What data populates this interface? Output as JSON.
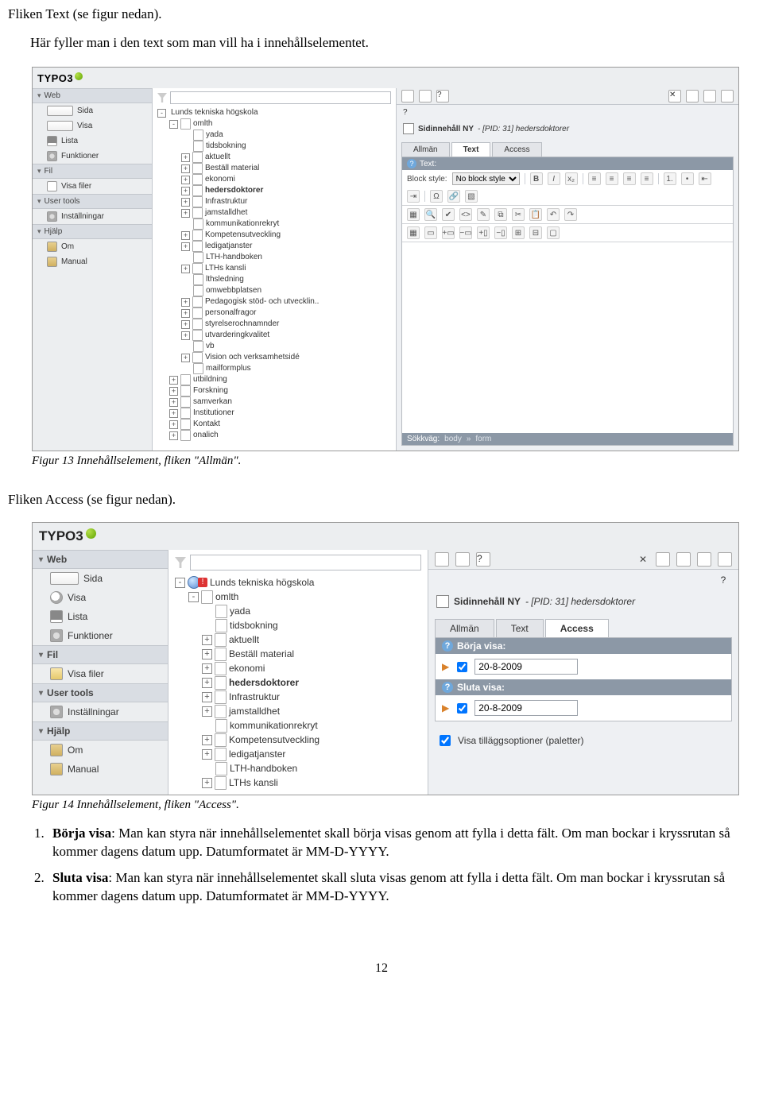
{
  "doc": {
    "line1": "Fliken Text (se figur nedan).",
    "line2": "Här fyller man i den text som man vill ha i innehållselementet.",
    "caption1": "Figur 13 Innehållselement, fliken \"Allmän\".",
    "heading2": "Fliken Access (se figur nedan).",
    "caption2": "Figur 14 Innehållselement, fliken \"Access\".",
    "list": [
      {
        "bold": "Börja visa",
        "rest": ": Man kan styra när innehållselementet skall börja visas genom att fylla i detta fält. Om man bockar i kryssrutan så kommer dagens datum upp. Datumformatet är MM-D-YYYY."
      },
      {
        "bold": "Sluta visa",
        "rest": ": Man kan styra när innehållselementet skall sluta visas genom att fylla i detta fält. Om man bockar i kryssrutan så kommer dagens datum upp. Datumformatet är MM-D-YYYY."
      }
    ],
    "page_number": "12"
  },
  "shot1": {
    "logo": "TYPO3",
    "nav": {
      "web": {
        "title": "Web",
        "items": [
          "Sida",
          "Visa",
          "Lista",
          "Funktioner"
        ]
      },
      "fil": {
        "title": "Fil",
        "items": [
          "Visa filer"
        ]
      },
      "user": {
        "title": "User tools",
        "items": [
          "Inställningar"
        ]
      },
      "help": {
        "title": "Hjälp",
        "items": [
          "Om",
          "Manual"
        ]
      }
    },
    "tree": [
      {
        "d": 0,
        "b": "-",
        "t": "globe",
        "l": "Lunds tekniska högskola"
      },
      {
        "d": 1,
        "b": "-",
        "t": "pg",
        "l": "omlth"
      },
      {
        "d": 2,
        "b": "",
        "t": "pg",
        "l": "yada"
      },
      {
        "d": 2,
        "b": "",
        "t": "pg",
        "l": "tidsbokning"
      },
      {
        "d": 2,
        "b": "+",
        "t": "pg",
        "l": "aktuellt"
      },
      {
        "d": 2,
        "b": "+",
        "t": "pg",
        "l": "Beställ material"
      },
      {
        "d": 2,
        "b": "+",
        "t": "pg",
        "l": "ekonomi"
      },
      {
        "d": 2,
        "b": "+",
        "t": "pg",
        "l": "hedersdoktorer",
        "sel": true
      },
      {
        "d": 2,
        "b": "+",
        "t": "pg",
        "l": "Infrastruktur"
      },
      {
        "d": 2,
        "b": "+",
        "t": "pg",
        "l": "jamstalldhet"
      },
      {
        "d": 2,
        "b": "",
        "t": "pg",
        "l": "kommunikationrekryt"
      },
      {
        "d": 2,
        "b": "+",
        "t": "pg",
        "l": "Kompetensutveckling"
      },
      {
        "d": 2,
        "b": "+",
        "t": "pg",
        "l": "ledigatjanster"
      },
      {
        "d": 2,
        "b": "",
        "t": "pg",
        "l": "LTH-handboken"
      },
      {
        "d": 2,
        "b": "+",
        "t": "pg",
        "l": "LTHs kansli"
      },
      {
        "d": 2,
        "b": "",
        "t": "pg",
        "l": "lthsledning"
      },
      {
        "d": 2,
        "b": "",
        "t": "pg",
        "l": "omwebbplatsen"
      },
      {
        "d": 2,
        "b": "+",
        "t": "pg",
        "l": "Pedagogisk stöd- och utvecklin.."
      },
      {
        "d": 2,
        "b": "+",
        "t": "pg",
        "l": "personalfragor"
      },
      {
        "d": 2,
        "b": "+",
        "t": "pg",
        "l": "styrelserochnamnder"
      },
      {
        "d": 2,
        "b": "+",
        "t": "pg",
        "l": "utvarderingkvalitet"
      },
      {
        "d": 2,
        "b": "",
        "t": "pg",
        "l": "vb"
      },
      {
        "d": 2,
        "b": "+",
        "t": "pg",
        "l": "Vision och verksamhetsidé"
      },
      {
        "d": 2,
        "b": "",
        "t": "pg",
        "l": "mailformplus"
      },
      {
        "d": 1,
        "b": "+",
        "t": "pg",
        "l": "utbildning"
      },
      {
        "d": 1,
        "b": "+",
        "t": "pg",
        "l": "Forskning"
      },
      {
        "d": 1,
        "b": "+",
        "t": "pg",
        "l": "samverkan"
      },
      {
        "d": 1,
        "b": "+",
        "t": "pg",
        "l": "Institutioner"
      },
      {
        "d": 1,
        "b": "+",
        "t": "pg",
        "l": "Kontakt"
      },
      {
        "d": 1,
        "b": "+",
        "t": "pg",
        "l": "onalich"
      }
    ],
    "right": {
      "title_strong": "Sidinnehåll NY",
      "title_rest": " - [PID: 31] hedersdoktorer",
      "tabs": [
        "Allmän",
        "Text",
        "Access"
      ],
      "active_tab": "Text",
      "panel_label": "Text:",
      "block_style_label": "Block style:",
      "block_style_value": "No block style",
      "path_label": "Sökkväg:",
      "path_segments": [
        "body",
        "form"
      ]
    }
  },
  "shot2": {
    "logo": "TYPO3",
    "nav": {
      "web": {
        "title": "Web",
        "items": [
          "Sida",
          "Visa",
          "Lista",
          "Funktioner"
        ]
      },
      "fil": {
        "title": "Fil",
        "items": [
          "Visa filer"
        ]
      },
      "user": {
        "title": "User tools",
        "items": [
          "Inställningar"
        ]
      },
      "help": {
        "title": "Hjälp",
        "items": [
          "Om",
          "Manual"
        ]
      }
    },
    "tree": [
      {
        "d": 0,
        "b": "-",
        "t": "globe",
        "l": "Lunds tekniska högskola",
        "warn": true
      },
      {
        "d": 1,
        "b": "-",
        "t": "pg",
        "l": "omlth"
      },
      {
        "d": 2,
        "b": "",
        "t": "pg",
        "l": "yada"
      },
      {
        "d": 2,
        "b": "",
        "t": "pg",
        "l": "tidsbokning"
      },
      {
        "d": 2,
        "b": "+",
        "t": "pg",
        "l": "aktuellt"
      },
      {
        "d": 2,
        "b": "+",
        "t": "pg",
        "l": "Beställ material"
      },
      {
        "d": 2,
        "b": "+",
        "t": "pg",
        "l": "ekonomi"
      },
      {
        "d": 2,
        "b": "+",
        "t": "pg",
        "l": "hedersdoktorer",
        "sel": true
      },
      {
        "d": 2,
        "b": "+",
        "t": "pg",
        "l": "Infrastruktur"
      },
      {
        "d": 2,
        "b": "+",
        "t": "pg",
        "l": "jamstalldhet"
      },
      {
        "d": 2,
        "b": "",
        "t": "pg",
        "l": "kommunikationrekryt"
      },
      {
        "d": 2,
        "b": "+",
        "t": "pg",
        "l": "Kompetensutveckling"
      },
      {
        "d": 2,
        "b": "+",
        "t": "pg",
        "l": "ledigatjanster"
      },
      {
        "d": 2,
        "b": "",
        "t": "pg",
        "l": "LTH-handboken"
      },
      {
        "d": 2,
        "b": "+",
        "t": "pg",
        "l": "LTHs kansli"
      }
    ],
    "right": {
      "title_strong": "Sidinnehåll NY",
      "title_rest": " - [PID: 31] hedersdoktorer",
      "tabs": [
        "Allmän",
        "Text",
        "Access"
      ],
      "active_tab": "Access",
      "begin_label": "Börja visa:",
      "end_label": "Sluta visa:",
      "begin_value": "20-8-2009",
      "end_value": "20-8-2009",
      "extra_checkbox_label": "Visa tilläggsoptioner (paletter)"
    }
  }
}
